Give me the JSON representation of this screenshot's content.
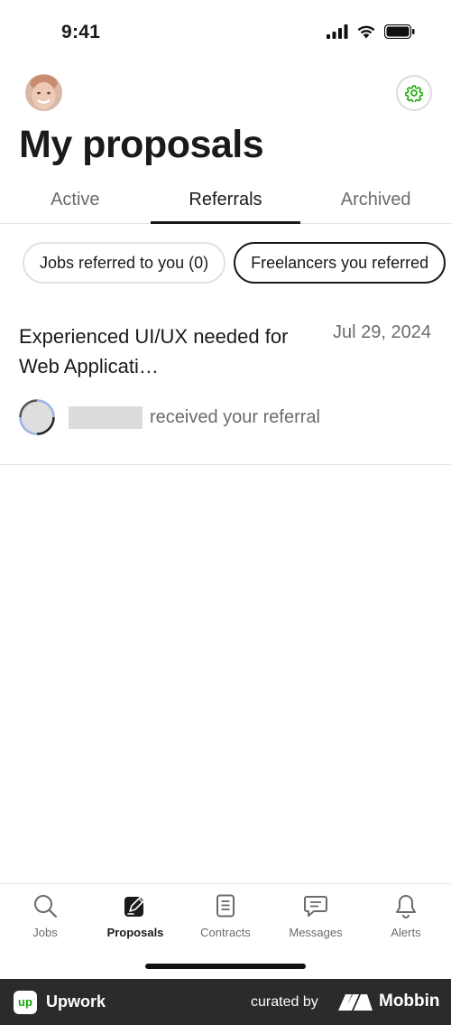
{
  "status_bar": {
    "time": "9:41"
  },
  "header": {
    "title": "My proposals"
  },
  "tabs": [
    {
      "label": "Active",
      "active": false
    },
    {
      "label": "Referrals",
      "active": true
    },
    {
      "label": "Archived",
      "active": false
    }
  ],
  "filters": [
    {
      "label": "Jobs referred to you (0)",
      "selected": false
    },
    {
      "label": "Freelancers you referred",
      "selected": true
    }
  ],
  "referrals": [
    {
      "job_title": "Experienced UI/UX needed for Web Applicati…",
      "date": "Jul 29, 2024",
      "status_text": "received your referral"
    }
  ],
  "bottom_nav": [
    {
      "label": "Jobs",
      "icon": "search-icon",
      "active": false
    },
    {
      "label": "Proposals",
      "icon": "proposals-icon",
      "active": true
    },
    {
      "label": "Contracts",
      "icon": "contracts-icon",
      "active": false
    },
    {
      "label": "Messages",
      "icon": "messages-icon",
      "active": false
    },
    {
      "label": "Alerts",
      "icon": "bell-icon",
      "active": false
    }
  ],
  "footer": {
    "brand_mark": "up",
    "brand": "Upwork",
    "curated_by": "curated by",
    "curator": "Mobbin"
  },
  "colors": {
    "accent_green": "#14a800",
    "text_primary": "#1a1a1a",
    "text_secondary": "#6b6b6b",
    "footer_bg": "#2b2b2b"
  }
}
